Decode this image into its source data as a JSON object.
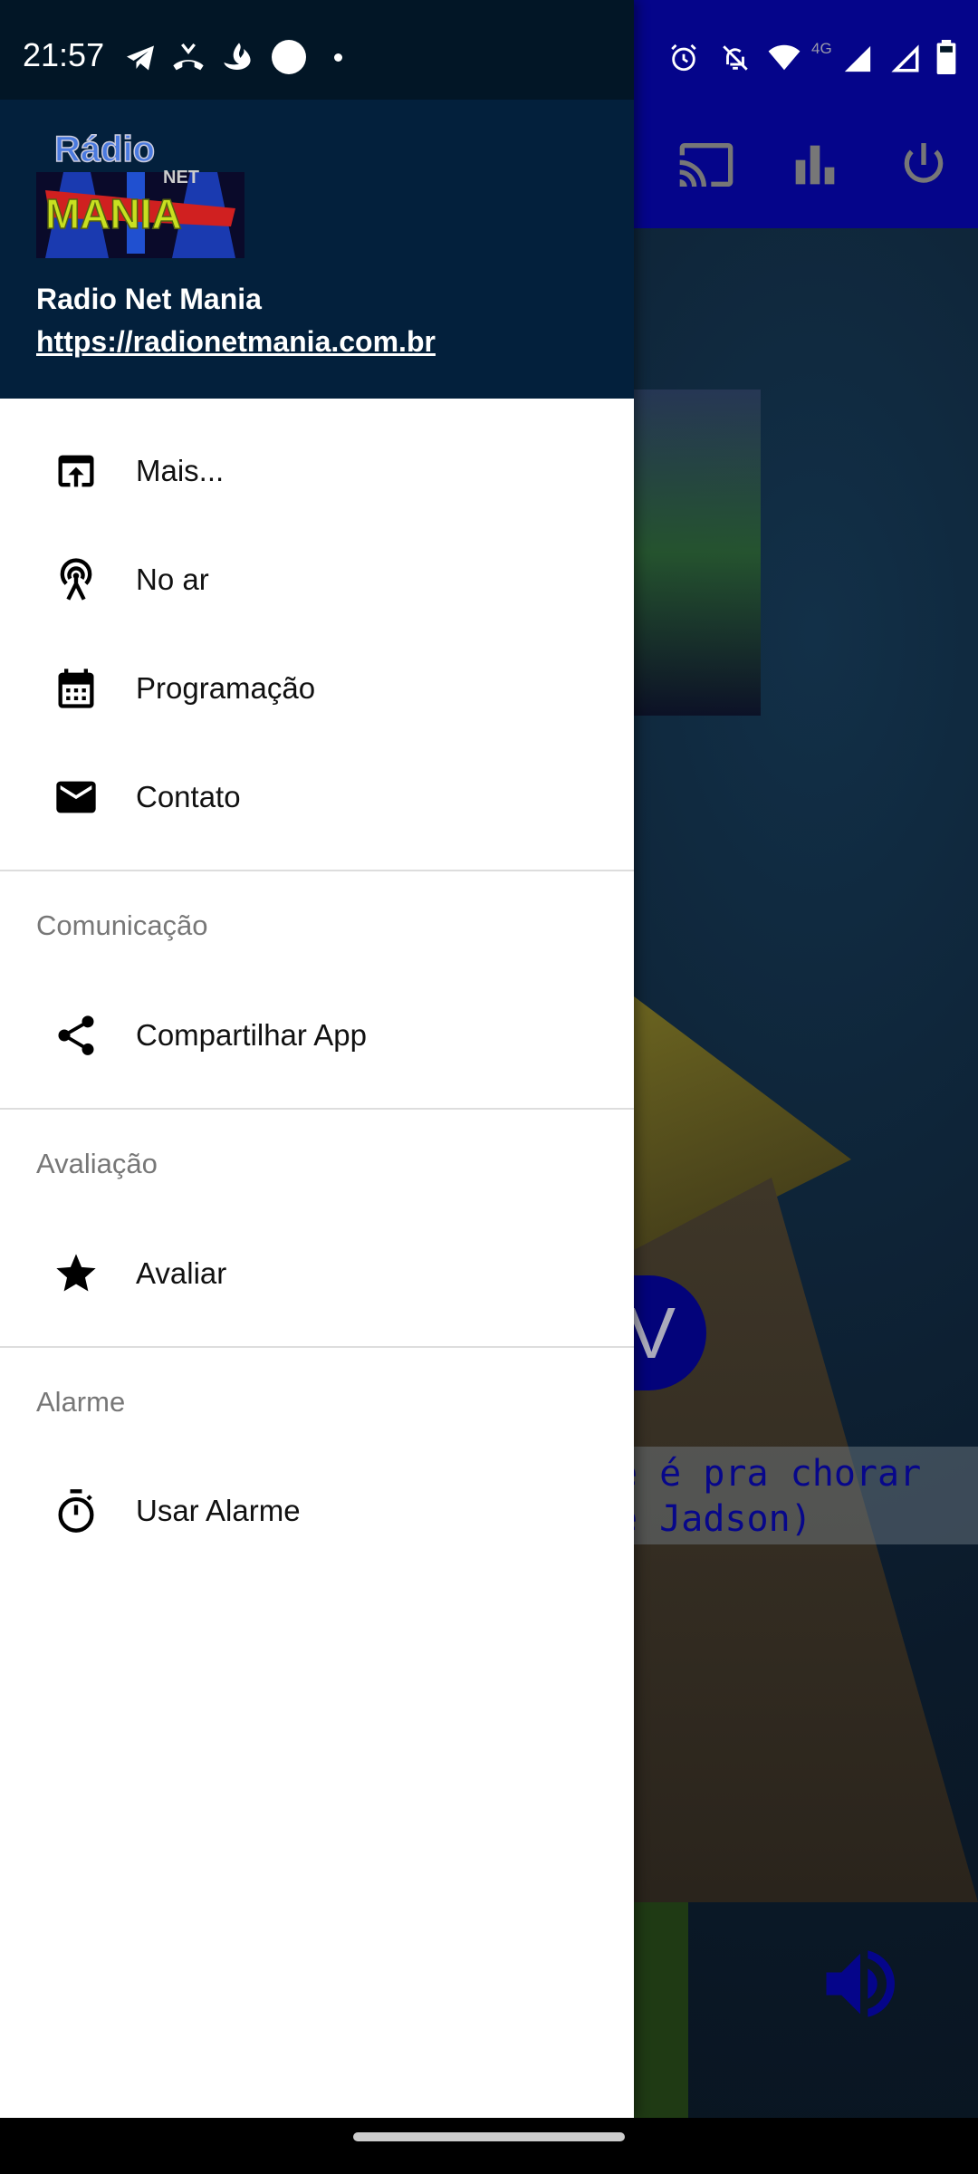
{
  "status_bar": {
    "time": "21:57",
    "left_icons": [
      "telegram-icon",
      "missed-call-icon",
      "santander-icon",
      "circle-icon",
      "dot-icon"
    ],
    "right_icons": [
      "alarm-icon",
      "bell-off-icon",
      "wifi-icon",
      "signal-icon",
      "signal-icon",
      "battery-icon"
    ],
    "network": "4G"
  },
  "app_bar": {
    "actions": [
      "cast-icon",
      "equalizer-icon",
      "power-icon"
    ],
    "color": "#05058a"
  },
  "background": {
    "button_letter": "V",
    "now_playing_line1": "e é pra chorar",
    "now_playing_line2": "e Jadson)"
  },
  "drawer": {
    "header": {
      "logo_text": "Rádio Net Mania",
      "station_name": "Radio Net Mania",
      "website": "https://radionetmania.com.br"
    },
    "items": [
      {
        "label": "Mais...",
        "icon": "open-in-browser-icon"
      },
      {
        "label": "No ar",
        "icon": "antenna-icon"
      },
      {
        "label": "Programação",
        "icon": "calendar-icon"
      },
      {
        "label": "Contato",
        "icon": "mail-icon"
      }
    ],
    "sections": [
      {
        "title": "Comunicação",
        "items": [
          {
            "label": "Compartilhar App",
            "icon": "share-icon"
          }
        ]
      },
      {
        "title": "Avaliação",
        "items": [
          {
            "label": "Avaliar",
            "icon": "star-icon"
          }
        ]
      },
      {
        "title": "Alarme",
        "items": [
          {
            "label": "Usar Alarme",
            "icon": "timer-icon"
          }
        ]
      }
    ]
  }
}
